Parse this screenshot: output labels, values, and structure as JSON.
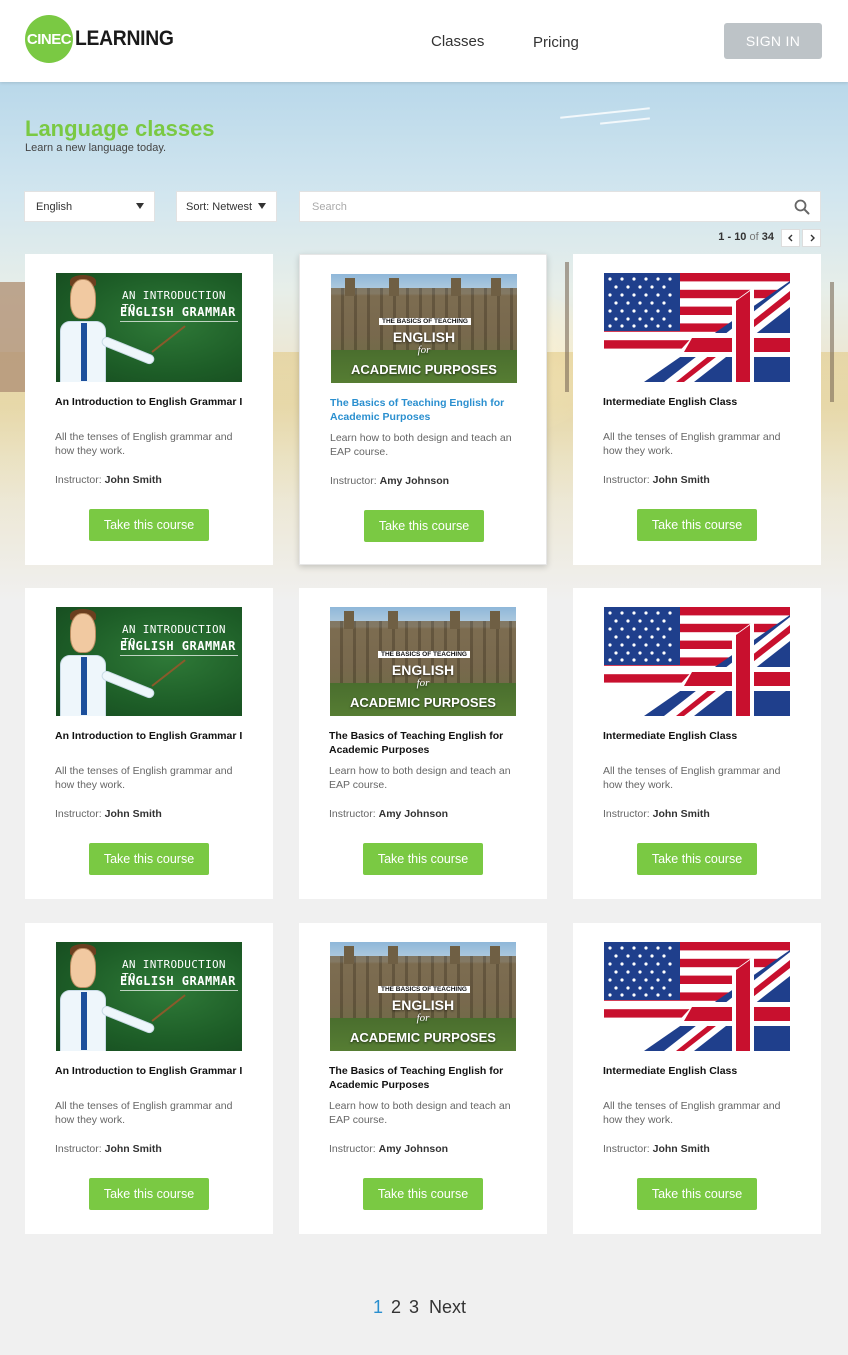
{
  "header": {
    "logo_mark": "CINEC",
    "logo_text": "LEARNING",
    "nav": [
      {
        "label": "Classes"
      },
      {
        "label": "Pricing"
      }
    ],
    "signin_label": "SIGN IN"
  },
  "page": {
    "title": "Language classes",
    "subtitle": "Learn a new language today."
  },
  "filters": {
    "language": "English",
    "sort": "Sort: Netwest",
    "search_placeholder": "Search"
  },
  "results": {
    "range": "1 - 10",
    "of": "of",
    "total": "34"
  },
  "courses": [
    {
      "title": "An Introduction to English Grammar I",
      "description": "All the tenses of English grammar and how they work.",
      "instructor_label": "Instructor:",
      "instructor": "John Smith",
      "button": "Take this course",
      "thumb": "grammar"
    },
    {
      "title": "The Basics of Teaching English for Academic Purposes",
      "description": "Learn how to both design and teach an EAP course.",
      "instructor_label": "Instructor:",
      "instructor": "Amy Johnson",
      "button": "Take this course",
      "thumb": "eap"
    },
    {
      "title": "Intermediate English Class",
      "description": "All the tenses of English grammar and how they work.",
      "instructor_label": "Instructor:",
      "instructor": "John Smith",
      "button": "Take this course",
      "thumb": "flag"
    },
    {
      "title": "An Introduction to English Grammar I",
      "description": "All the tenses of English grammar and how they work.",
      "instructor_label": "Instructor:",
      "instructor": "John Smith",
      "button": "Take this course",
      "thumb": "grammar"
    },
    {
      "title": "The Basics of Teaching English for Academic Purposes",
      "description": "Learn how to both design and teach an EAP course.",
      "instructor_label": "Instructor:",
      "instructor": "Amy Johnson",
      "button": "Take this course",
      "thumb": "eap"
    },
    {
      "title": "Intermediate English Class",
      "description": "All the tenses of English grammar and how they work.",
      "instructor_label": "Instructor:",
      "instructor": "John Smith",
      "button": "Take this course",
      "thumb": "flag"
    },
    {
      "title": "An Introduction to English Grammar I",
      "description": "All the tenses of English grammar and how they work.",
      "instructor_label": "Instructor:",
      "instructor": "John Smith",
      "button": "Take this course",
      "thumb": "grammar"
    },
    {
      "title": "The Basics of Teaching English for Academic Purposes",
      "description": "Learn how to both design and teach an EAP course.",
      "instructor_label": "Instructor:",
      "instructor": "Amy Johnson",
      "button": "Take this course",
      "thumb": "eap"
    },
    {
      "title": "Intermediate English Class",
      "description": "All the tenses of English grammar and how they work.",
      "instructor_label": "Instructor:",
      "instructor": "John Smith",
      "button": "Take this course",
      "thumb": "flag"
    }
  ],
  "thumbnails": {
    "grammar": {
      "line1": "AN INTRODUCTION TO",
      "line2": "ENGLISH GRAMMAR"
    },
    "eap": {
      "line1": "THE BASICS OF TEACHING",
      "line2": "ENGLISH",
      "line3": "for",
      "line4": "ACADEMIC PURPOSES"
    }
  },
  "pagination": {
    "pages": [
      "1",
      "2",
      "3"
    ],
    "current": "1",
    "next_label": "Next"
  },
  "colors": {
    "accent_green": "#7ac943",
    "link_blue": "#2a8fcf",
    "signin_gray": "#bdc3c7"
  }
}
